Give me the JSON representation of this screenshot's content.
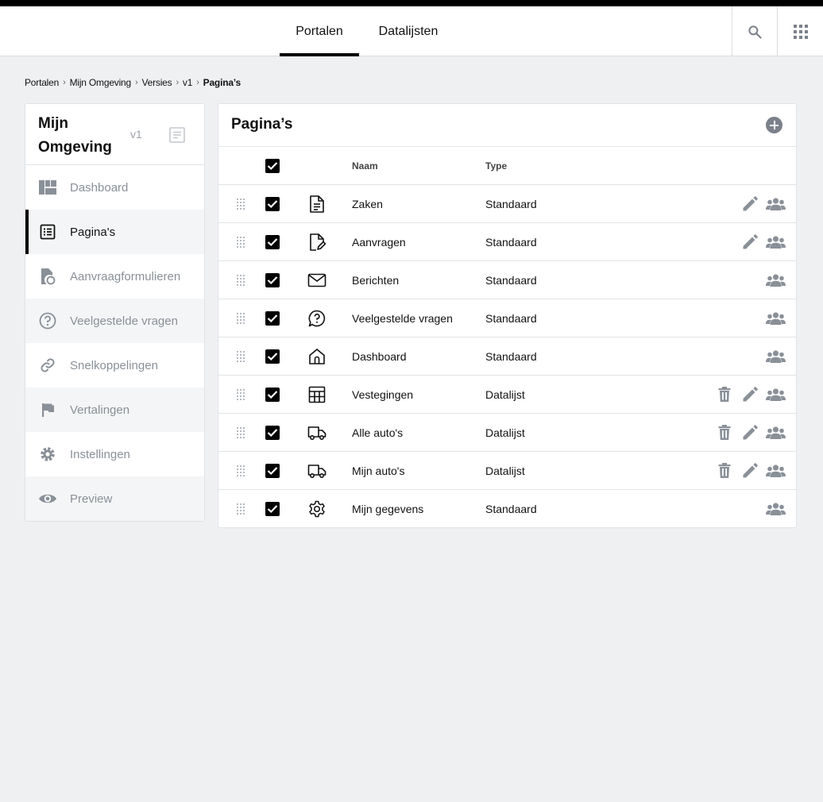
{
  "topnav": {
    "tabs": [
      {
        "label": "Portalen",
        "active": true
      },
      {
        "label": "Datalijsten",
        "active": false
      }
    ],
    "search_icon": "search-icon",
    "apps_icon": "apps-grid-icon"
  },
  "breadcrumb": [
    "Portalen",
    "Mijn Omgeving",
    "Versies",
    "v1",
    "Pagina’s"
  ],
  "sidebar": {
    "title": "Mijn Omgeving",
    "version": "v1",
    "items": [
      {
        "label": "Dashboard",
        "icon": "dashboard-icon"
      },
      {
        "label": "Pagina's",
        "icon": "list-icon",
        "active": true
      },
      {
        "label": "Aanvraagformulieren",
        "icon": "form-refresh-icon"
      },
      {
        "label": "Veelgestelde vragen",
        "icon": "help-icon"
      },
      {
        "label": "Snelkoppelingen",
        "icon": "link-icon"
      },
      {
        "label": "Vertalingen",
        "icon": "flag-icon"
      },
      {
        "label": "Instellingen",
        "icon": "gear-icon"
      },
      {
        "label": "Preview",
        "icon": "eye-icon"
      }
    ]
  },
  "panel": {
    "title": "Pagina’s",
    "columns": {
      "name": "Naam",
      "type": "Type"
    },
    "rows": [
      {
        "name": "Zaken",
        "type": "Standaard",
        "icon": "document-icon",
        "actions": [
          "edit",
          "users"
        ]
      },
      {
        "name": "Aanvragen",
        "type": "Standaard",
        "icon": "document-edit-icon",
        "actions": [
          "edit",
          "users"
        ]
      },
      {
        "name": "Berichten",
        "type": "Standaard",
        "icon": "mail-icon",
        "actions": [
          "users"
        ]
      },
      {
        "name": "Veelgestelde vragen",
        "type": "Standaard",
        "icon": "question-bubble-icon",
        "actions": [
          "users"
        ]
      },
      {
        "name": "Dashboard",
        "type": "Standaard",
        "icon": "home-icon",
        "actions": [
          "users"
        ]
      },
      {
        "name": "Vestegingen",
        "type": "Datalijst",
        "icon": "table-icon",
        "actions": [
          "delete",
          "edit",
          "users"
        ]
      },
      {
        "name": "Alle auto's",
        "type": "Datalijst",
        "icon": "truck-icon",
        "actions": [
          "delete",
          "edit",
          "users"
        ]
      },
      {
        "name": "Mijn auto's",
        "type": "Datalijst",
        "icon": "truck-icon",
        "actions": [
          "delete",
          "edit",
          "users"
        ]
      },
      {
        "name": "Mijn gegevens",
        "type": "Standaard",
        "icon": "gear-icon",
        "actions": [
          "users"
        ]
      }
    ]
  },
  "colors": {
    "accent": "#000000",
    "muted": "#8a9098",
    "background": "#eef0f2"
  }
}
